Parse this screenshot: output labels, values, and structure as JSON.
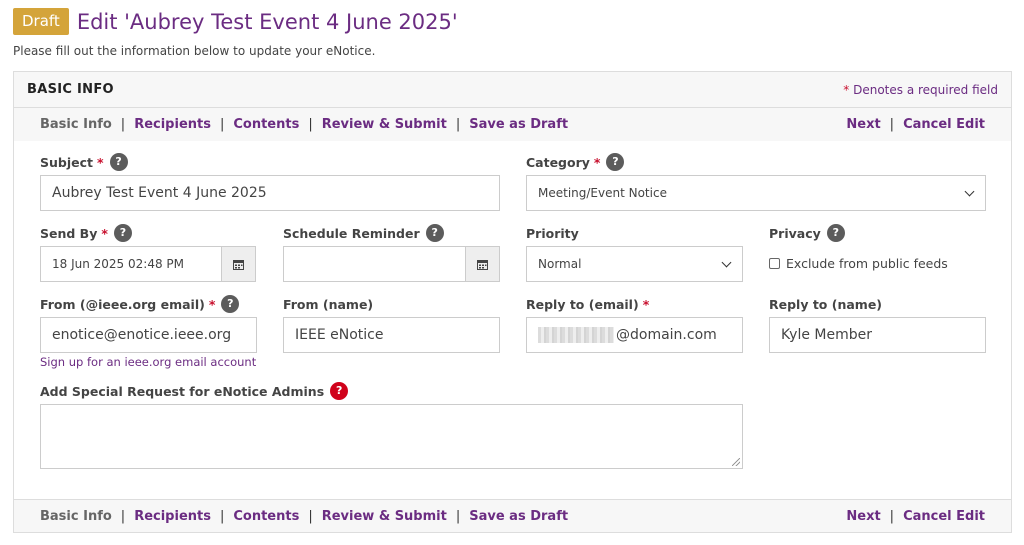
{
  "header": {
    "badge": "Draft",
    "title": "Edit 'Aubrey Test Event 4 June 2025'",
    "subtitle": "Please fill out the information below to update your eNotice."
  },
  "panel": {
    "title": "BASIC INFO",
    "required_star": "*",
    "required_note": "Denotes a required field"
  },
  "nav": {
    "items": [
      "Basic Info",
      "Recipients",
      "Contents",
      "Review & Submit",
      "Save as Draft"
    ],
    "separator": "|",
    "next": "Next",
    "cancel": "Cancel Edit"
  },
  "form": {
    "subject": {
      "label": "Subject",
      "value": "Aubrey Test Event 4 June 2025"
    },
    "category": {
      "label": "Category",
      "value": "Meeting/Event Notice"
    },
    "send_by": {
      "label": "Send By",
      "value": "18 Jun 2025 02:48 PM"
    },
    "schedule_reminder": {
      "label": "Schedule Reminder",
      "value": ""
    },
    "priority": {
      "label": "Priority",
      "value": "Normal"
    },
    "privacy": {
      "label": "Privacy",
      "checkbox_label": "Exclude from public feeds",
      "checked": false
    },
    "from_email": {
      "label": "From (@ieee.org email)",
      "value": "enotice@enotice.ieee.org",
      "link": "Sign up for an ieee.org email account"
    },
    "from_name": {
      "label": "From (name)",
      "value": "IEEE eNotice"
    },
    "reply_email": {
      "label": "Reply to (email)",
      "value": "@domain.com"
    },
    "reply_name": {
      "label": "Reply to (name)",
      "value": "Kyle Member"
    },
    "special_request": {
      "label": "Add Special Request for eNotice Admins",
      "value": ""
    }
  },
  "colors": {
    "accent": "#6b2c82",
    "badge": "#d4a43a",
    "required": "#c8102e",
    "help_red": "#d0021b"
  }
}
